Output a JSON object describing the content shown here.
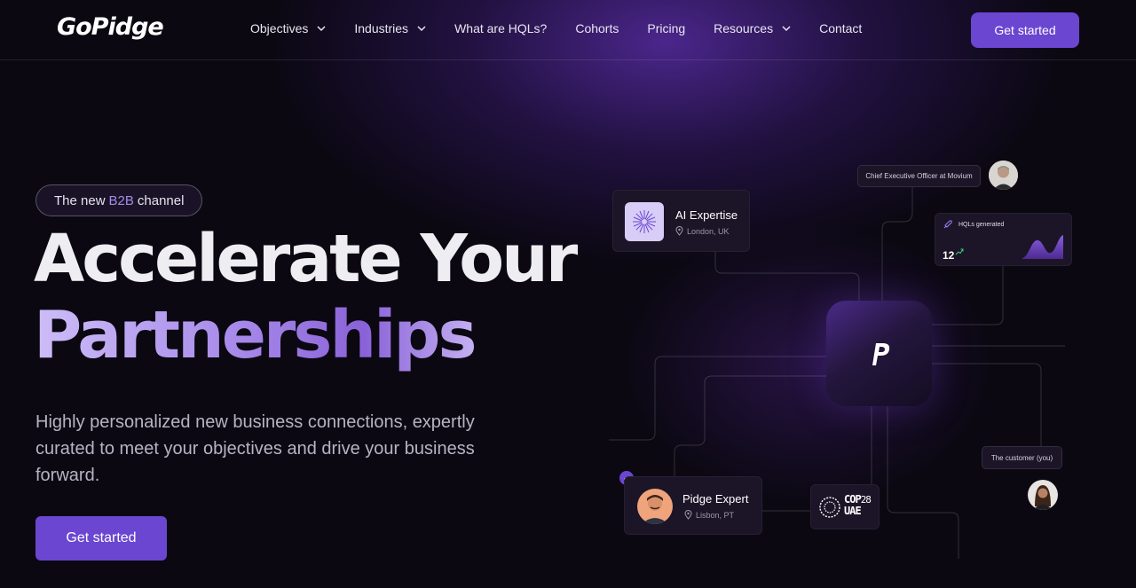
{
  "brand": {
    "logo_text": "GoPidge",
    "accent": "#6b46d1"
  },
  "nav": {
    "items": [
      {
        "label": "Objectives",
        "dropdown": true
      },
      {
        "label": "Industries",
        "dropdown": true
      },
      {
        "label": "What are HQLs?",
        "dropdown": false
      },
      {
        "label": "Cohorts",
        "dropdown": false
      },
      {
        "label": "Pricing",
        "dropdown": false
      },
      {
        "label": "Resources",
        "dropdown": true
      },
      {
        "label": "Contact",
        "dropdown": false
      }
    ],
    "cta_label": "Get started"
  },
  "hero": {
    "badge_prefix": "The new",
    "badge_highlight": "B2B",
    "badge_suffix": "channel",
    "title_line1": "Accelerate Your",
    "title_line2": "Partnerships",
    "subtitle": "Highly personalized new business connections, expertly curated to meet your objectives and drive your business forward.",
    "cta_label": "Get started"
  },
  "illustration": {
    "ai_card": {
      "title": "AI Expertise",
      "location": "London, UK",
      "icon": "starburst-icon"
    },
    "ceo_label": "Chief Executive Officer at Movium",
    "hql_card": {
      "label": "HQLs generated",
      "value": "12",
      "icon": "rocket-icon"
    },
    "center_icon": "pidge-logo-icon",
    "expert_card": {
      "title": "Pidge Expert",
      "location": "Lisbon, PT"
    },
    "event_logo": {
      "line1": "COP",
      "line2": "28",
      "line3": "UAE"
    },
    "customer_label": "The customer (you)"
  }
}
